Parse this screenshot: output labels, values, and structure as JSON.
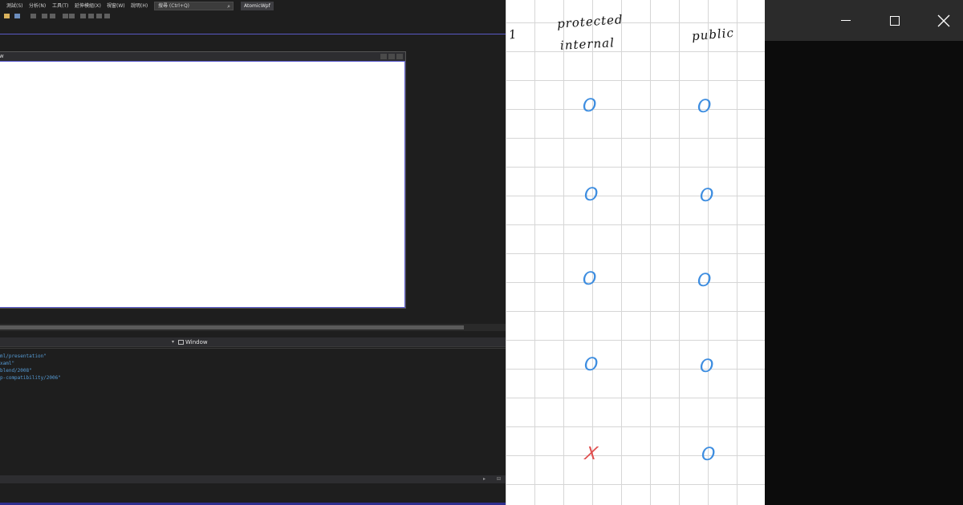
{
  "vs": {
    "menu": [
      "測試(S)",
      "分析(N)",
      "工具(T)",
      "延伸模組(X)",
      "視窗(W)",
      "說明(H)"
    ],
    "search_placeholder": "搜尋 (Ctrl+Q)",
    "search_icon": "search-icon",
    "solution_name": "AtomicWpf",
    "designer_window_title": "w",
    "element_label": "Window",
    "xaml_lines": [
      "ml/presentation\"",
      "xaml\"",
      "blend/2008\"",
      "p-compatibility/2006\""
    ],
    "accent_color": "#5959c5"
  },
  "notes": {
    "row_marker": "1",
    "col1_header_line1": "protected",
    "col1_header_line2": "internal",
    "col2_header": "public",
    "col1_marks": [
      "O",
      "O",
      "O",
      "O",
      "X"
    ],
    "col2_marks": [
      "O",
      "O",
      "O",
      "O",
      "O"
    ],
    "colors": {
      "ink": "#111111",
      "blue": "#3d8de0",
      "red": "#e05050",
      "grid": "#d6d6d6"
    }
  },
  "window_controls": {
    "icons": [
      "minimize-icon",
      "maximize-icon",
      "close-icon"
    ],
    "titlebar_color": "#2b2b2b",
    "body_color": "#0c0c0c"
  }
}
